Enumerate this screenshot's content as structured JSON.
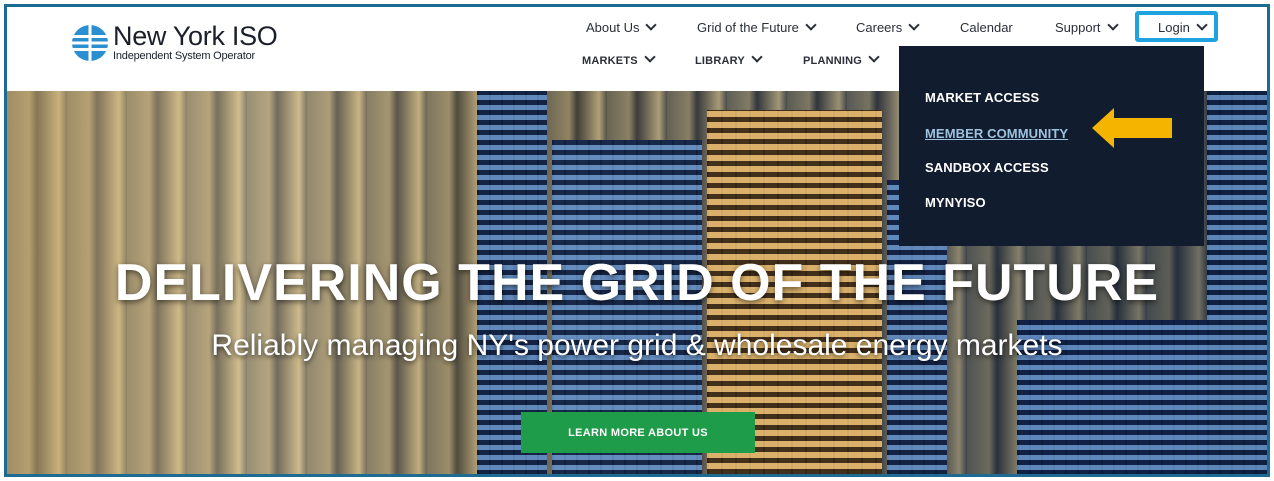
{
  "logo": {
    "title": "New York ISO",
    "subtitle": "Independent System Operator"
  },
  "nav_top": [
    "About Us",
    "Grid of the Future",
    "Careers",
    "Calendar",
    "Support",
    "Login"
  ],
  "nav_bottom": [
    "MARKETS",
    "LIBRARY",
    "PLANNING"
  ],
  "dropdown": [
    "MARKET ACCESS",
    "MEMBER COMMUNITY",
    "SANDBOX ACCESS",
    "MYNYISO"
  ],
  "hero": {
    "title": "DELIVERING THE GRID OF THE FUTURE",
    "subtitle": "Reliably managing NY's power grid & wholesale energy markets",
    "cta": "LEARN MORE ABOUT US"
  },
  "colors": {
    "accent_highlight": "#1ea2e0",
    "cta_green": "#1f9c4a",
    "dropdown_bg": "#111d2e",
    "arrow": "#f5b400",
    "frame": "#1d6a93"
  }
}
